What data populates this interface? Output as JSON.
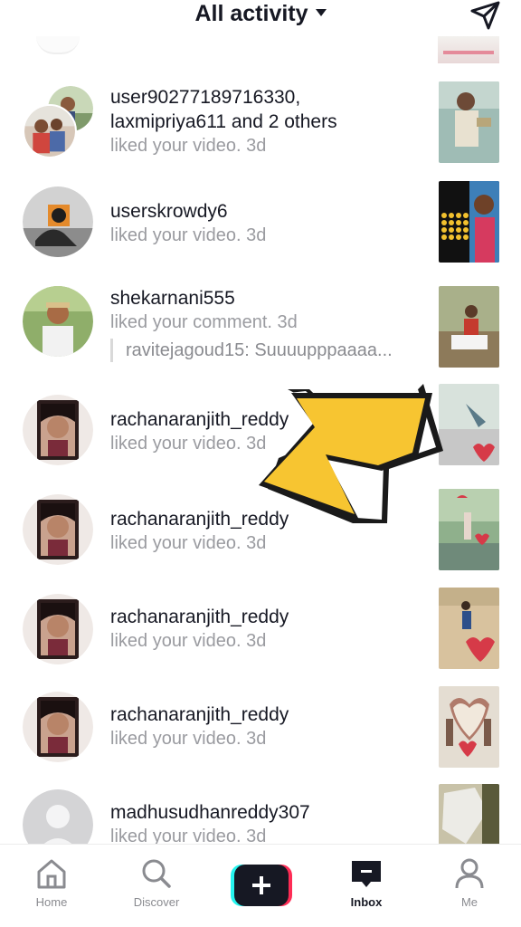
{
  "header": {
    "title": "All activity",
    "send_icon": "send-paper-plane-icon"
  },
  "activity": [
    {
      "username": "user90277189716330,",
      "second_line_user": "laxmipriya611",
      "second_line_and": " and ",
      "second_line_others": "2 others",
      "action": "liked your video.",
      "time": "3d"
    },
    {
      "username": "userskrowdy6",
      "action": "liked your video.",
      "time": "3d"
    },
    {
      "username": "shekarnani555",
      "action": "liked your comment.",
      "time": "3d",
      "quote": "ravitejagoud15: Suuuupppaaaa..."
    },
    {
      "username": "rachanaranjith_reddy",
      "action": "liked your video.",
      "time": "3d"
    },
    {
      "username": "rachanaranjith_reddy",
      "action": "liked your video.",
      "time": "3d"
    },
    {
      "username": "rachanaranjith_reddy",
      "action": "liked your video.",
      "time": "3d"
    },
    {
      "username": "rachanaranjith_reddy",
      "action": "liked your video.",
      "time": "3d"
    },
    {
      "username": "madhusudhanreddy307",
      "action": "liked your video.",
      "time": "3d"
    }
  ],
  "nav": {
    "home": "Home",
    "discover": "Discover",
    "create_icon": "plus-icon",
    "inbox": "Inbox",
    "me": "Me",
    "active": "inbox"
  },
  "colors": {
    "arrow": "#f7c531",
    "create_cyan": "#25f4ee",
    "create_pink": "#fe2c55"
  }
}
